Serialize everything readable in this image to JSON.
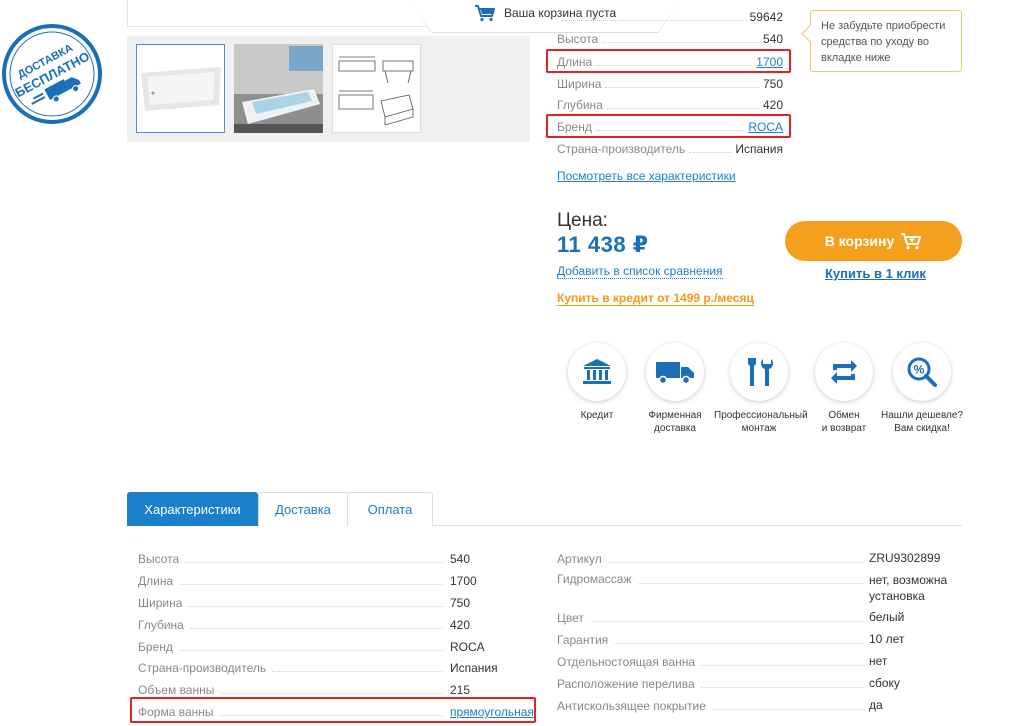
{
  "cart": {
    "label": "Ваша корзина пуста"
  },
  "badge": {
    "line1": "ДОСТАВКА",
    "line2": "БЕСПЛАТНО"
  },
  "short_specs": [
    {
      "key": "",
      "value": "59642",
      "link": false
    },
    {
      "key": "Высота",
      "value": "540",
      "link": false
    },
    {
      "key": "Длина",
      "value": "1700",
      "link": true
    },
    {
      "key": "Ширина",
      "value": "750",
      "link": false
    },
    {
      "key": "Глубина",
      "value": "420",
      "link": false
    },
    {
      "key": "Бренд",
      "value": "ROCA",
      "link": true
    },
    {
      "key": "Страна-производитель",
      "value": "Испания",
      "link": false
    }
  ],
  "all_chars_link": "Посмотреть все характеристики",
  "tooltip": "Не забудьте приобрести средства по уходу во вкладке ниже",
  "price": {
    "label": "Цена:",
    "value": "11 438 ₽"
  },
  "compare_link": "Добавить в список сравнения",
  "credit_link": "Купить в кредит от 1499 р./месяц",
  "cart_button": "В корзину",
  "one_click": "Купить в 1 клик",
  "services": [
    {
      "icon": "bank-icon",
      "label": "Кредит"
    },
    {
      "icon": "truck-icon",
      "label": "Фирменная\nдоставка"
    },
    {
      "icon": "tools-icon",
      "label": "Профессиональный\nмонтаж"
    },
    {
      "icon": "exchange-icon",
      "label": "Обмен\nи возврат"
    },
    {
      "icon": "discount-search-icon",
      "label": "Нашли дешевле?\nВам скидка!"
    }
  ],
  "tabs": [
    {
      "label": "Характеристики",
      "active": true
    },
    {
      "label": "Доставка",
      "active": false
    },
    {
      "label": "Оплата",
      "active": false
    }
  ],
  "chars_left": [
    {
      "key": "Высота",
      "value": "540"
    },
    {
      "key": "Длина",
      "value": "1700"
    },
    {
      "key": "Ширина",
      "value": "750"
    },
    {
      "key": "Глубина",
      "value": "420"
    },
    {
      "key": "Бренд",
      "value": "ROCA"
    },
    {
      "key": "Страна-производитель",
      "value": "Испания"
    },
    {
      "key": "Объем ванны",
      "value": "215"
    },
    {
      "key": "Форма ванны",
      "value": "прямоугольная",
      "link": true
    }
  ],
  "chars_right": [
    {
      "key": "Артикул",
      "value": "ZRU9302899"
    },
    {
      "key": "Гидромассаж",
      "value": "нет, возможна установка"
    },
    {
      "key": "Цвет",
      "value": "белый"
    },
    {
      "key": "Гарантия",
      "value": "10 лет"
    },
    {
      "key": "Отдельностоящая ванна",
      "value": "нет"
    },
    {
      "key": "Расположение перелива",
      "value": "сбоку"
    },
    {
      "key": "Антискользящее покрытие",
      "value": "да"
    }
  ],
  "colors": {
    "accent_blue": "#1b7fcc",
    "orange": "#f5a01c",
    "highlight_red": "#e52222"
  }
}
